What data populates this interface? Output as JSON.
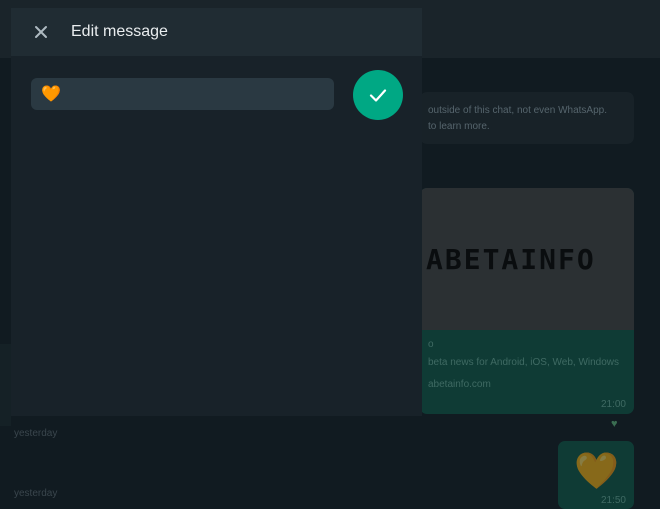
{
  "background": {
    "banner_text": "ƑWABETAINFO",
    "info_text_1": "outside of this chat, not even WhatsApp.",
    "info_text_2": "to learn more.",
    "card_image_text": "ABETAINFO",
    "card_text_1": "o",
    "card_text_2": "beta news for Android, iOS, Web, Windows",
    "card_text_3": "abetainfo.com",
    "card_time": "21:00",
    "day_label_1": "yesterday",
    "day_label_2": "yesterday",
    "heart_time": "21:50",
    "heart_emoji": "🧡"
  },
  "panel": {
    "title": "Edit message",
    "input_value": "🧡"
  },
  "colors": {
    "accent": "#00a884",
    "panel_bg": "#182229",
    "header_bg": "#202c33",
    "input_bg": "#2a3942"
  }
}
